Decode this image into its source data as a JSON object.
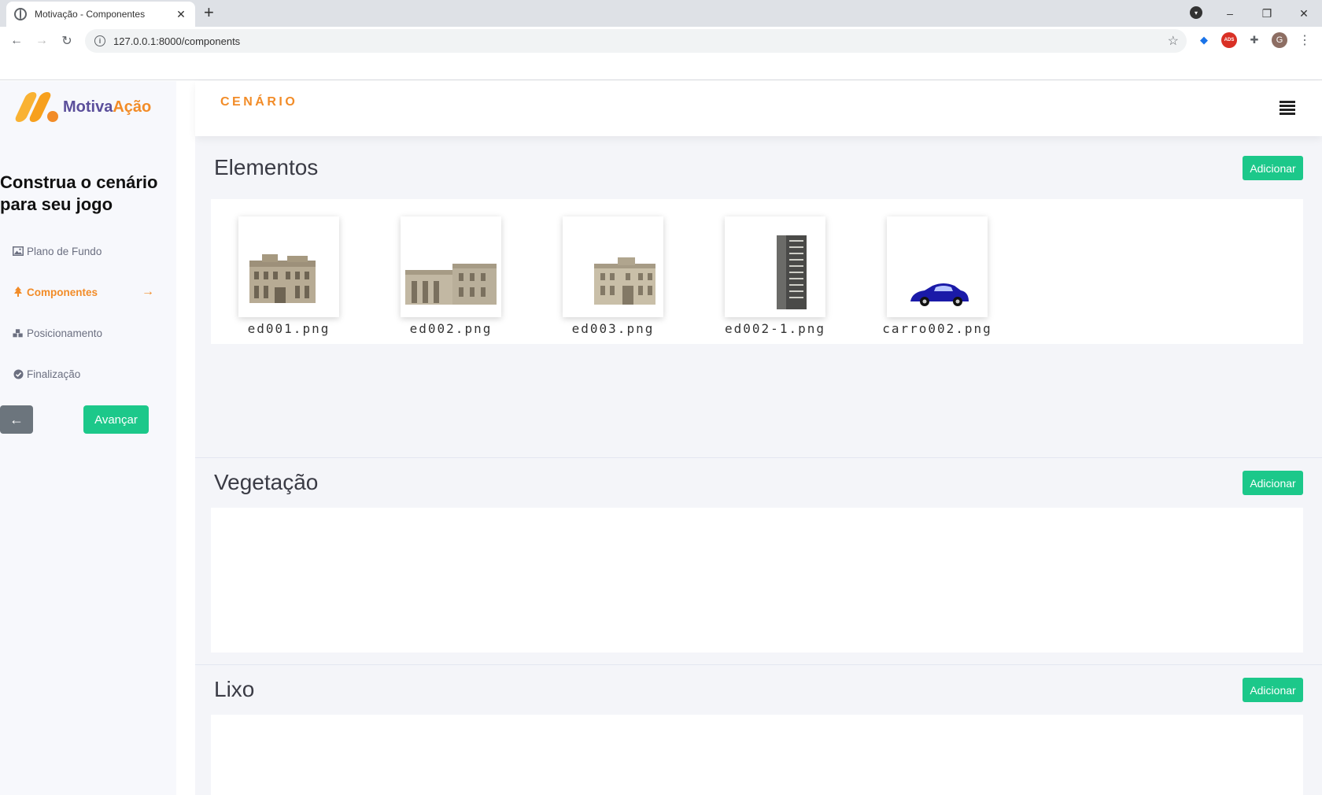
{
  "browser": {
    "tab_title": "Motivação - Componentes",
    "tab_close": "✕",
    "new_tab": "+",
    "url": "127.0.0.1:8000/components",
    "profile_initial": "G",
    "ext_ads_label": "ADS",
    "window": {
      "minimize": "–",
      "restore": "❐",
      "close": "✕"
    }
  },
  "sidebar": {
    "logo_part1": "Motiva",
    "logo_part2": "Ação",
    "heading": "Construa o cenário para seu jogo",
    "items": [
      {
        "label": "Plano de Fundo",
        "icon": "image-icon",
        "active": false
      },
      {
        "label": "Componentes",
        "icon": "tree-icon",
        "active": true
      },
      {
        "label": "Posicionamento",
        "icon": "cubes-icon",
        "active": false
      },
      {
        "label": "Finalização",
        "icon": "check-circle-icon",
        "active": false
      }
    ],
    "active_arrow": "→",
    "back_label": "←",
    "next_label": "Avançar"
  },
  "header": {
    "title": "CENÁRIO"
  },
  "sections": [
    {
      "title": "Elementos",
      "add_label": "Adicionar",
      "items": [
        {
          "name": "ed001.png"
        },
        {
          "name": "ed002.png"
        },
        {
          "name": "ed003.png"
        },
        {
          "name": "ed002-1.png"
        },
        {
          "name": "carro002.png"
        }
      ]
    },
    {
      "title": "Vegetação",
      "add_label": "Adicionar",
      "items": []
    },
    {
      "title": "Lixo",
      "add_label": "Adicionar",
      "items": []
    }
  ],
  "colors": {
    "accent_orange": "#f28c28",
    "brand_purple": "#5b4f9b",
    "success_green": "#1cc88a",
    "secondary_gray": "#6c757d"
  }
}
